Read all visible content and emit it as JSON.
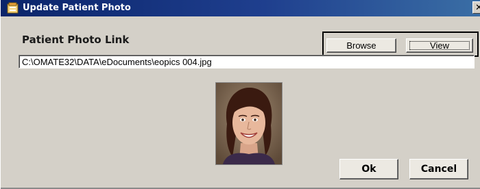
{
  "window": {
    "title": "Update Patient Photo",
    "close_glyph": "✕"
  },
  "photo_link": {
    "label": "Patient Photo Link",
    "value": "C:\\OMATE32\\DATA\\eDocuments\\eopics 004.jpg"
  },
  "buttons": {
    "browse": "Browse",
    "view": "View",
    "ok": "Ok",
    "cancel": "Cancel"
  },
  "photo": {
    "icon": "patient-photo"
  },
  "colors": {
    "titlebar": "#0a246a",
    "dialog_bg": "#d4d0c8"
  }
}
